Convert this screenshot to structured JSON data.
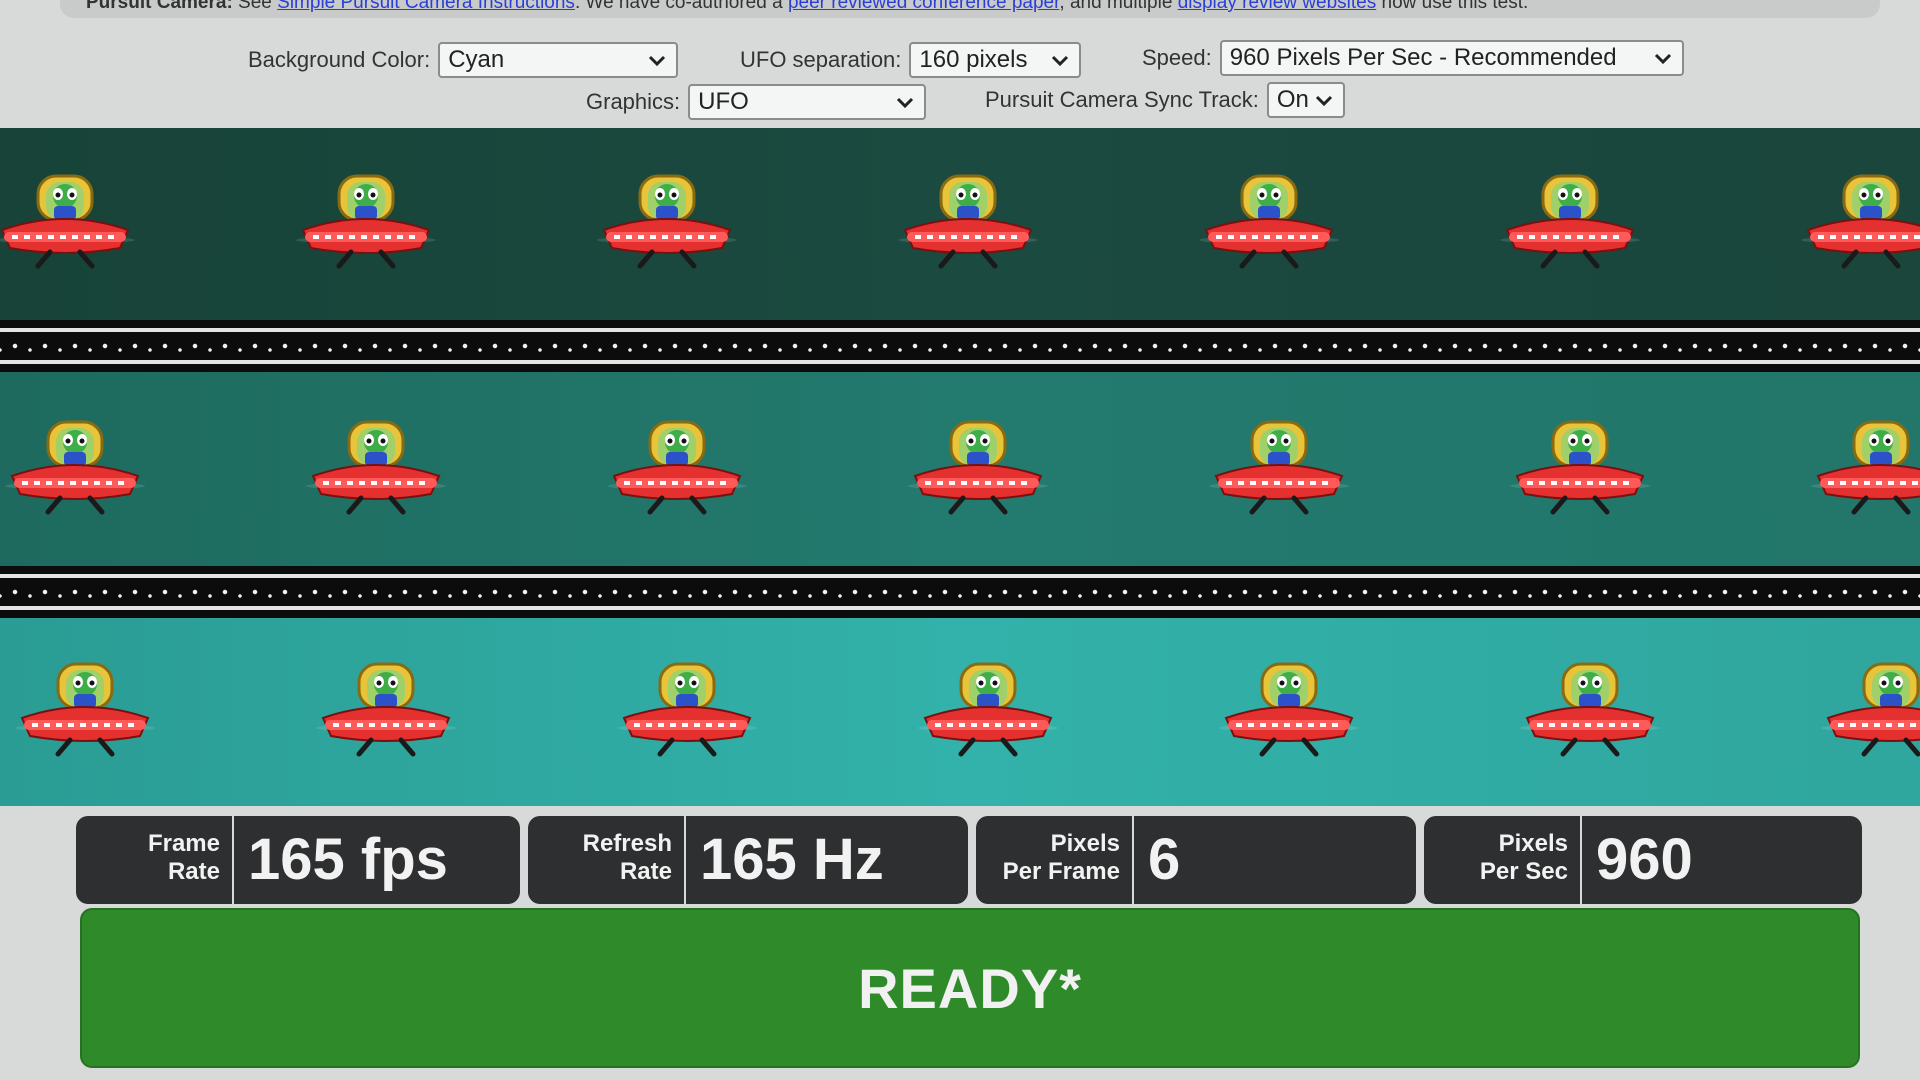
{
  "topline": {
    "lead_label": "Pursuit Camera:",
    "text_see": " See ",
    "link1": "Simple Pursuit Camera Instructions",
    "text_mid": ". We have co-authored a ",
    "link2": "peer reviewed conference paper",
    "text_and": ", and multiple ",
    "link3": "display review websites",
    "text_end": " now use this test."
  },
  "controls": {
    "background_color": {
      "label": "Background Color:",
      "value": "Cyan"
    },
    "ufo_separation": {
      "label": "UFO separation:",
      "value": "160 pixels"
    },
    "speed": {
      "label": "Speed:",
      "value": "960 Pixels Per Sec - Recommended"
    },
    "graphics": {
      "label": "Graphics:",
      "value": "UFO"
    },
    "sync_track": {
      "label": "Pursuit Camera Sync Track:",
      "value": "On"
    }
  },
  "stats": {
    "frame_rate": {
      "label_line1": "Frame",
      "label_line2": "Rate",
      "value": "165 fps"
    },
    "refresh_rate": {
      "label_line1": "Refresh",
      "label_line2": "Rate",
      "value": "165 Hz"
    },
    "pixels_per_frame": {
      "label_line1": "Pixels",
      "label_line2": "Per Frame",
      "value": "6"
    },
    "pixels_per_sec": {
      "label_line1": "Pixels",
      "label_line2": "Per Sec",
      "value": "960"
    }
  },
  "ready": {
    "label": "READY*"
  },
  "colors": {
    "band_top": "#1b4a40",
    "band_middle": "#237a6e",
    "band_bottom": "#32b2aa",
    "ready_green": "#2f8a2a",
    "stat_bg": "#2d2f30",
    "link_blue": "#2a3fd6"
  },
  "icons": {
    "ufo": "ufo-alien-icon",
    "dropdown": "chevron-down-icon"
  }
}
